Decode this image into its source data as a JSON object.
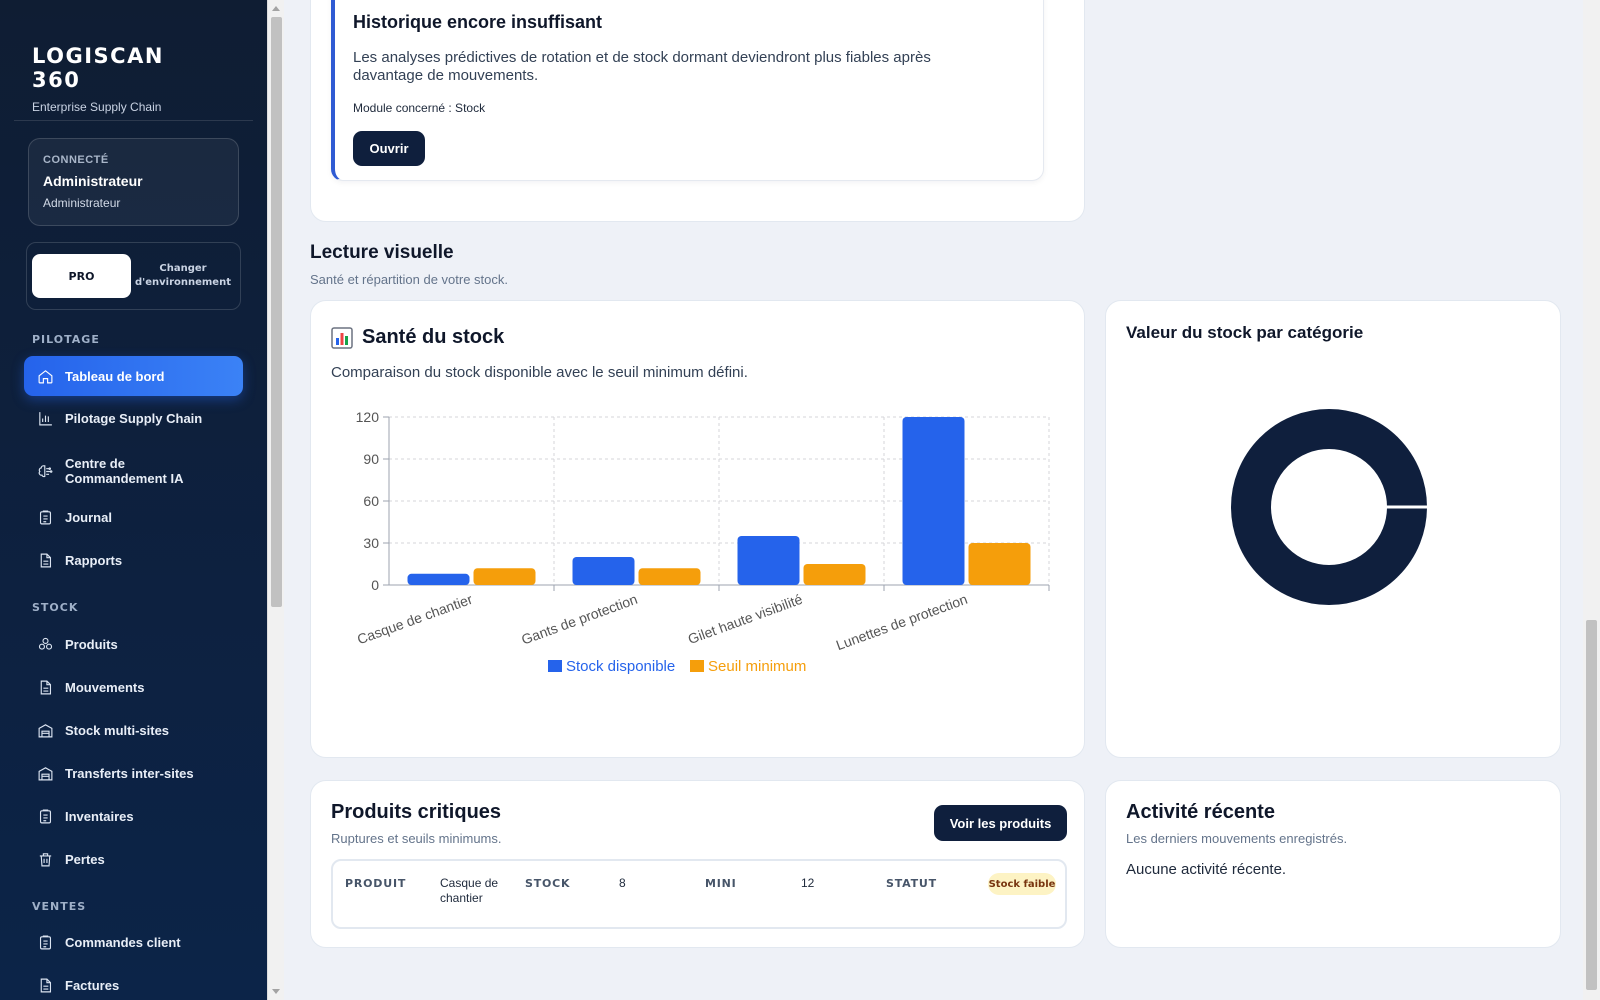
{
  "sidebar": {
    "brand_title": "LOGISCAN 360",
    "brand_subtitle": "Enterprise Supply Chain",
    "user": {
      "status_label": "CONNECTÉ",
      "name": "Administrateur",
      "role": "Administrateur"
    },
    "environment": {
      "current": "PRO",
      "change_label": "Changer d'environnement"
    },
    "sections": [
      {
        "label": "PILOTAGE",
        "items": [
          {
            "label": "Tableau de bord",
            "icon": "home-icon",
            "active": true
          },
          {
            "label": "Pilotage Supply Chain",
            "icon": "bar-chart-icon"
          },
          {
            "label": "Centre de Commandement IA",
            "icon": "brain-icon"
          },
          {
            "label": "Journal",
            "icon": "clipboard-icon"
          },
          {
            "label": "Rapports",
            "icon": "document-icon"
          }
        ]
      },
      {
        "label": "STOCK",
        "items": [
          {
            "label": "Produits",
            "icon": "boxes-icon"
          },
          {
            "label": "Mouvements",
            "icon": "document-icon"
          },
          {
            "label": "Stock multi-sites",
            "icon": "warehouse-icon"
          },
          {
            "label": "Transferts inter-sites",
            "icon": "warehouse-icon"
          },
          {
            "label": "Inventaires",
            "icon": "clipboard-icon"
          },
          {
            "label": "Pertes",
            "icon": "trash-icon"
          }
        ]
      },
      {
        "label": "VENTES",
        "items": [
          {
            "label": "Commandes client",
            "icon": "clipboard-icon"
          },
          {
            "label": "Factures",
            "icon": "document-icon"
          }
        ]
      }
    ]
  },
  "alert": {
    "title": "Historique encore insuffisant",
    "text": "Les analyses prédictives de rotation et de stock dormant deviendront plus fiables après davantage de mouvements.",
    "module": "Module concerné : Stock",
    "button": "Ouvrir"
  },
  "visual_section": {
    "title": "Lecture visuelle",
    "subtitle": "Santé et répartition de votre stock."
  },
  "stock_chart": {
    "title": "Santé du stock",
    "description": "Comparaison du stock disponible avec le seuil minimum défini.",
    "colors": {
      "available": "#2563eb",
      "minimum": "#f59e0b"
    }
  },
  "chart_data": [
    {
      "type": "bar",
      "title": "Santé du stock",
      "categories": [
        "Casque de chantier",
        "Gants de protection",
        "Gilet haute visibilité",
        "Lunettes de protection"
      ],
      "series": [
        {
          "name": "Stock disponible",
          "values": [
            8,
            20,
            35,
            120
          ]
        },
        {
          "name": "Seuil minimum",
          "values": [
            12,
            12,
            15,
            30
          ]
        }
      ],
      "ylim": [
        0,
        120
      ],
      "yticks": [
        0,
        30,
        60,
        90,
        120
      ],
      "grid": true,
      "legend": "bottom"
    },
    {
      "type": "pie",
      "title": "Valeur du stock par catégorie",
      "categories": [
        ""
      ],
      "values": [
        100
      ],
      "colors": [
        "#0f1f3d"
      ]
    }
  ],
  "donut": {
    "title": "Valeur du stock par catégorie",
    "color": "#0f1f3d"
  },
  "critical": {
    "title": "Produits critiques",
    "subtitle": "Ruptures et seuils minimums.",
    "button": "Voir les produits",
    "headers": {
      "product": "PRODUIT",
      "stock": "STOCK",
      "min": "MINI",
      "status": "STATUT"
    },
    "row": {
      "product": "Casque de chantier",
      "stock": "8",
      "min": "12",
      "status": "Stock faible"
    }
  },
  "activity": {
    "title": "Activité récente",
    "subtitle": "Les derniers mouvements enregistrés.",
    "empty": "Aucune activité récente."
  }
}
